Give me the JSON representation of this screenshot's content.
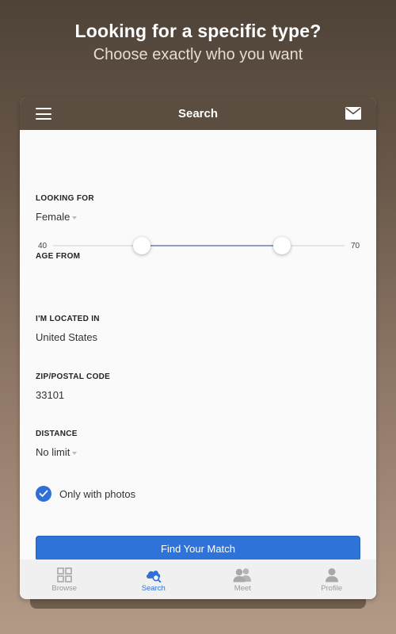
{
  "promo": {
    "title": "Looking for a specific type?",
    "subtitle": "Choose exactly who you want"
  },
  "appbar": {
    "title": "Search",
    "menu_icon": "hamburger-menu-icon",
    "mail_icon": "envelope-icon"
  },
  "form": {
    "looking_for": {
      "label": "LOOKING FOR",
      "value": "Female"
    },
    "age": {
      "label": "AGE FROM",
      "min_label": "40",
      "max_label": "70",
      "low_fraction": 0.305,
      "high_fraction": 0.785
    },
    "location": {
      "label": "I'M LOCATED IN",
      "value": "United States"
    },
    "zip": {
      "label": "ZIP/POSTAL CODE",
      "value": "33101"
    },
    "distance": {
      "label": "DISTANCE",
      "value": "No limit"
    },
    "photos_only": {
      "label": "Only with photos",
      "checked": true
    },
    "submit_label": "Find Your Match"
  },
  "nav": {
    "items": [
      {
        "label": "Browse",
        "icon": "grid-icon",
        "active": false
      },
      {
        "label": "Search",
        "icon": "search-cloud-icon",
        "active": true
      },
      {
        "label": "Meet",
        "icon": "people-icon",
        "active": false
      },
      {
        "label": "Profile",
        "icon": "user-icon",
        "active": false
      }
    ]
  },
  "colors": {
    "accent": "#2f73d9",
    "appbar": "#5b4d40",
    "slider_fill": "#8c9fc7"
  }
}
